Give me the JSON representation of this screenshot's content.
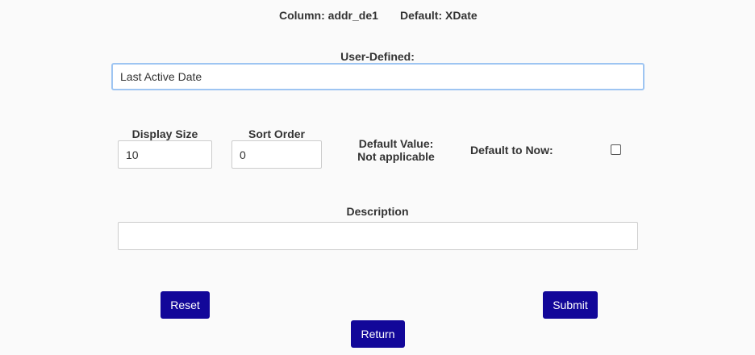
{
  "header": {
    "column_text": "Column: addr_de1",
    "default_text": "Default: XDate"
  },
  "user_defined": {
    "label": "User-Defined:",
    "value": "Last Active Date"
  },
  "display_size": {
    "label": "Display Size",
    "value": "10"
  },
  "sort_order": {
    "label": "Sort Order",
    "value": "0"
  },
  "default_value": {
    "label": "Default Value:",
    "value": "Not applicable"
  },
  "default_to_now": {
    "label": "Default to Now:",
    "checked": false
  },
  "description": {
    "label": "Description",
    "value": ""
  },
  "buttons": {
    "reset": "Reset",
    "submit": "Submit",
    "return": "Return"
  },
  "colors": {
    "button_bg": "#120799",
    "focus_border": "#9ec5f2"
  }
}
